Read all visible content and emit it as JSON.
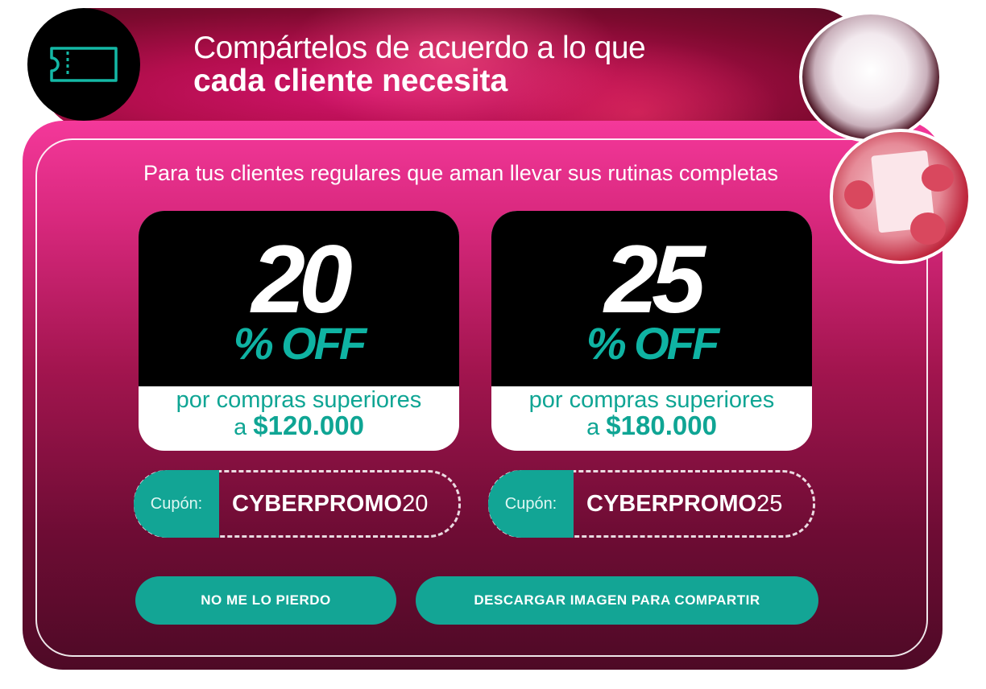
{
  "header": {
    "title_line1": "Compártelos de acuerdo a lo que",
    "title_line2": "cada cliente necesita",
    "icon": "ticket-icon"
  },
  "panel": {
    "subtitle": "Para tus clientes regulares que aman llevar sus rutinas completas"
  },
  "offers": [
    {
      "percent": "20",
      "off_label": "% OFF",
      "condition_line1": "por compras superiores",
      "condition_prefix": "a",
      "amount": "$120.000",
      "coupon_label": "Cupón:",
      "coupon_code_bold": "CYBERPROMO",
      "coupon_code_num": "20"
    },
    {
      "percent": "25",
      "off_label": "% OFF",
      "condition_line1": "por compras superiores",
      "condition_prefix": "a",
      "amount": "$180.000",
      "coupon_label": "Cupón:",
      "coupon_code_bold": "CYBERPROMO",
      "coupon_code_num": "25"
    }
  ],
  "buttons": {
    "primary": "NO ME LO PIERDO",
    "secondary": "DESCARGAR IMAGEN PARA COMPARTIR"
  },
  "colors": {
    "accent": "#13a595",
    "magenta": "#d8287d",
    "dark": "#000000"
  }
}
